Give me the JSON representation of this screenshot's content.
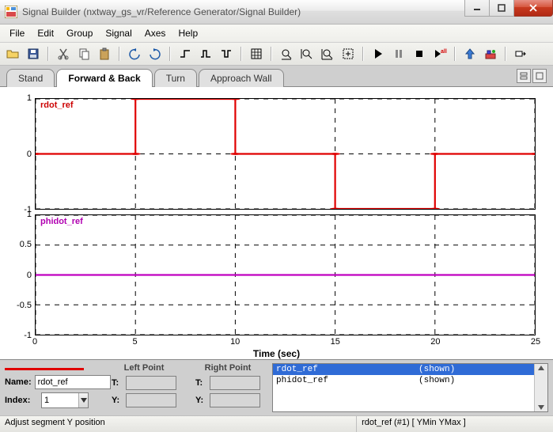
{
  "window": {
    "title": "Signal Builder (nxtway_gs_vr/Reference Generator/Signal Builder)"
  },
  "menu": [
    "File",
    "Edit",
    "Group",
    "Signal",
    "Axes",
    "Help"
  ],
  "tabs": [
    {
      "label": "Stand",
      "active": false
    },
    {
      "label": "Forward & Back",
      "active": true
    },
    {
      "label": "Turn",
      "active": false
    },
    {
      "label": "Approach Wall",
      "active": false
    }
  ],
  "xaxis": {
    "label": "Time (sec)",
    "min": 0,
    "max": 25,
    "ticks": [
      0,
      5,
      10,
      15,
      20,
      25
    ]
  },
  "axes": [
    {
      "signal_name": "rdot_ref",
      "color": "#e00000",
      "ymin": -1,
      "ymax": 1,
      "yticks": [
        -1,
        0,
        1
      ],
      "label_class": "red"
    },
    {
      "signal_name": "phidot_ref",
      "color": "#c000c0",
      "ymin": -1,
      "ymax": 1,
      "yticks": [
        -1,
        -0.5,
        0,
        0.5,
        1
      ],
      "label_class": "mag"
    }
  ],
  "chart_data": [
    {
      "type": "line",
      "name": "rdot_ref",
      "color": "#e00000",
      "x": [
        0,
        5,
        5,
        10,
        10,
        15,
        15,
        20,
        20,
        25
      ],
      "y": [
        0,
        0,
        1,
        1,
        0,
        0,
        -1,
        -1,
        0,
        0
      ],
      "markers_x": [
        0,
        5,
        5,
        10,
        10,
        15,
        15,
        20,
        20,
        25
      ],
      "markers_y": [
        0,
        0,
        1,
        1,
        0,
        0,
        -1,
        -1,
        0,
        0
      ],
      "xlim": [
        0,
        25
      ],
      "ylim": [
        -1,
        1
      ]
    },
    {
      "type": "line",
      "name": "phidot_ref",
      "color": "#c000c0",
      "x": [
        0,
        25
      ],
      "y": [
        0,
        0
      ],
      "xlim": [
        0,
        25
      ],
      "ylim": [
        -1,
        1
      ]
    }
  ],
  "bottom": {
    "swatch_label": "",
    "left_point_label": "Left Point",
    "right_point_label": "Right Point",
    "name_label": "Name:",
    "name_value": "rdot_ref",
    "index_label": "Index:",
    "index_value": "1",
    "T_label": "T:",
    "Y_label": "Y:"
  },
  "signal_list": [
    {
      "name": "rdot_ref",
      "vis": "(shown)",
      "selected": true
    },
    {
      "name": "phidot_ref",
      "vis": "(shown)",
      "selected": false
    }
  ],
  "status": {
    "left": "Adjust segment Y position",
    "right": "rdot_ref (#1)  [ YMin YMax ]"
  }
}
